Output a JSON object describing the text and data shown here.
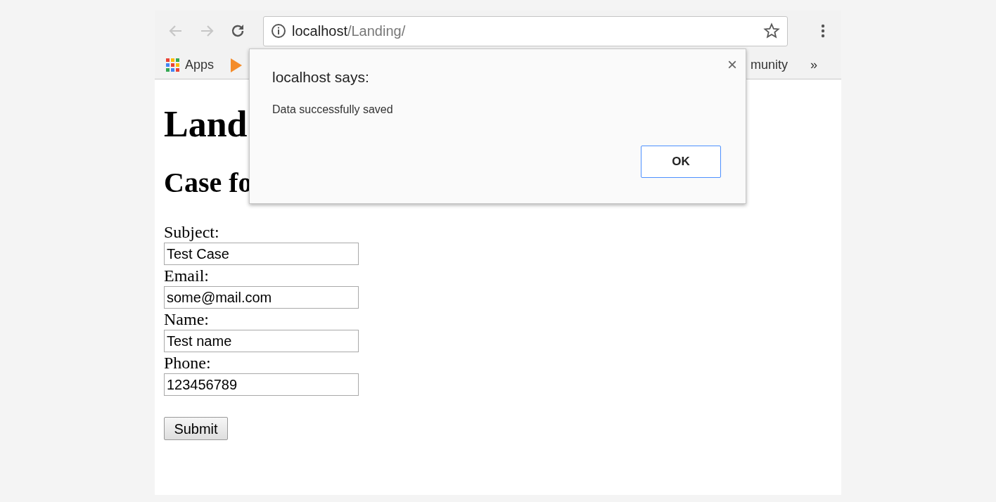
{
  "address_bar": {
    "host": "localhost",
    "path": "/Landing/"
  },
  "bookmarks": [
    {
      "kind": "apps",
      "label": "Apps"
    },
    {
      "kind": "play"
    },
    {
      "kind": "spacer"
    },
    {
      "kind": "text",
      "label": "munity"
    }
  ],
  "bookmarks_overflow": "»",
  "page": {
    "heading": "Land",
    "subheading": "Case fo",
    "fields": [
      {
        "label": "Subject:",
        "value": "Test Case"
      },
      {
        "label": "Email:",
        "value": "some@mail.com"
      },
      {
        "label": "Name:",
        "value": "Test name"
      },
      {
        "label": "Phone:",
        "value": "123456789"
      }
    ],
    "submit": "Submit"
  },
  "dialog": {
    "title": "localhost says:",
    "message": "Data successfully saved",
    "button": "OK",
    "close": "×"
  }
}
